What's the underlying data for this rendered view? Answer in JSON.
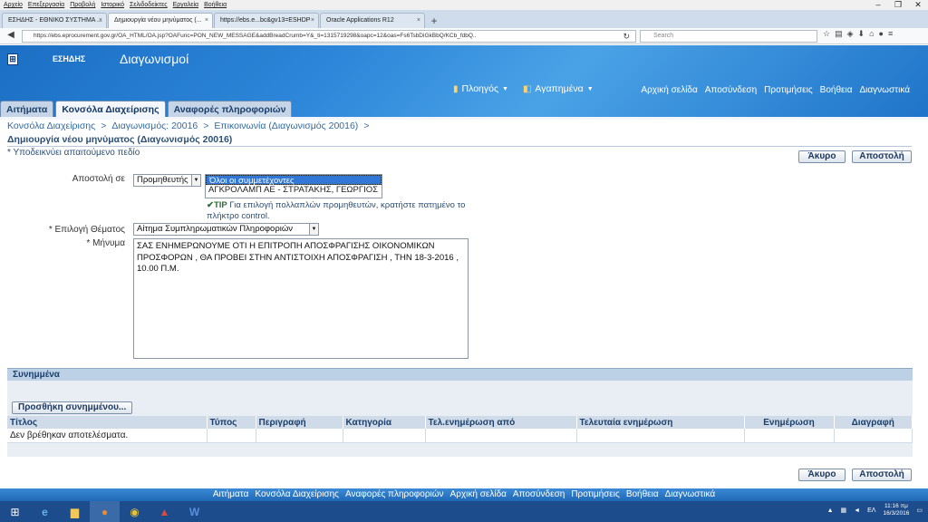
{
  "browser": {
    "menu": [
      "Αρχείο",
      "Επεξεργασία",
      "Προβολή",
      "Ιστορικό",
      "Σελιδοδείκτες",
      "Εργαλεία",
      "Βοήθεια"
    ],
    "tabs": [
      {
        "label": "ΕΣΗΔΗΣ - ΕΘΝΙΚΟ ΣΥΣΤΗΜΑ ..."
      },
      {
        "label": "Δημιουργία νέου μηνύματος (..."
      },
      {
        "label": "https://ebs.e...bc&gv13=ESHDP"
      },
      {
        "label": "Oracle Applications R12"
      }
    ],
    "url": "https://ebs.eprocurement.gov.gr/OA_HTML/OA.jsp?OAFunc=PON_NEW_MESSAGE&addBreadCrumb=Y&_ti=1315719298&oapc=12&oas=Fs6TsbDiGkBbQ/KCb_fdbQ..",
    "search_placeholder": "Search"
  },
  "app": {
    "brand": "ΕΣΗΔΗΣ",
    "title": "Διαγωνισμοί",
    "nav_menu": "Πλοηγός",
    "favorites_menu": "Αγαπημένα",
    "global_links": [
      "Αρχική σελίδα",
      "Αποσύνδεση",
      "Προτιμήσεις",
      "Βοήθεια",
      "Διαγνωστικά"
    ],
    "tabs": [
      "Αιτήματα",
      "Κονσόλα Διαχείρισης",
      "Αναφορές πληροφοριών"
    ]
  },
  "breadcrumb": [
    "Κονσόλα Διαχείρισης",
    "Διαγωνισμός: 20016",
    "Επικοινωνία (Διαγωνισμός 20016)"
  ],
  "breadcrumb_sep": ">",
  "page": {
    "title": "Δημιουργία νέου μηνύματος (Διαγωνισμός 20016)",
    "required_note": "* Υποδεικνύει απαιτούμενο πεδίο",
    "cancel": "Άκυρο",
    "send": "Αποστολή"
  },
  "form": {
    "send_to_label": "Αποστολή σε",
    "send_to_value": "Προμηθευτής",
    "recipients": [
      "Όλοι οι συμμετέχοντες",
      "ΑΓΚΡΟΛΑΜΠ ΑΕ - ΣΤΡΑΤΑΚΗΣ, ΓΕΩΡΓΙΟΣ"
    ],
    "tip_label": "TIP",
    "tip_text": "Για επιλογή πολλαπλών προμηθευτών, κρατήστε πατημένο το πλήκτρο control.",
    "subject_label": "* Επιλογή Θέματος",
    "subject_value": "Αίτημα Συμπληρωματικών Πληροφοριών",
    "message_label": "* Μήνυμα",
    "message_value": "ΣΑΣ ΕΝΗΜΕΡΩΝΟΥΜΕ ΟΤΙ Η ΕΠΙΤΡΟΠΗ ΑΠΟΣΦΡΑΓΙΣΗΣ ΟΙΚΟΝΟΜΙΚΩΝ ΠΡΟΣΦΟΡΩΝ , ΘΑ ΠΡΟΒΕΙ ΣΤΗΝ ΑΝΤΙΣΤΟΙΧΗ ΑΠΟΣΦΡΑΓΙΣΗ , ΤΗΝ 18-3-2016 , 10.00 Π.Μ."
  },
  "attachments": {
    "header": "Συνημμένα",
    "add_button": "Προσθήκη συνημμένου...",
    "columns": [
      "Τίτλος",
      "Τύπος",
      "Περιγραφή",
      "Κατηγορία",
      "Τελ.ενημέρωση από",
      "Τελευταία ενημέρωση",
      "Ενημέρωση",
      "Διαγραφή"
    ],
    "empty": "Δεν βρέθηκαν αποτελέσματα."
  },
  "footer_links": [
    "Αιτήματα",
    "Κονσόλα Διαχείρισης",
    "Αναφορές πληροφοριών",
    "Αρχική σελίδα",
    "Αποσύνδεση",
    "Προτιμήσεις",
    "Βοήθεια",
    "Διαγνωστικά"
  ],
  "taskbar": {
    "lang": "ΕΛ",
    "time": "11:16 πμ",
    "date": "16/3/2016"
  }
}
